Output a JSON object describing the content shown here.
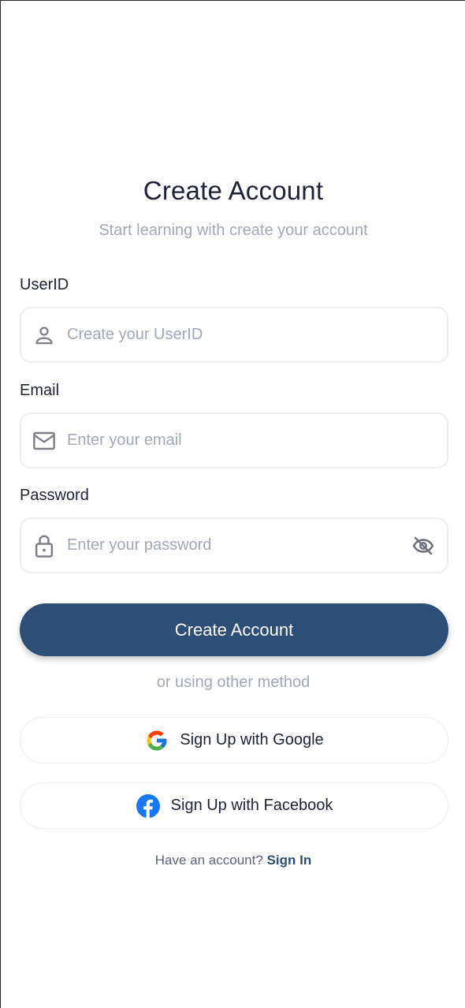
{
  "header": {
    "title": "Create Account",
    "subtitle": "Start learning with create your account"
  },
  "form": {
    "userid": {
      "label": "UserID",
      "placeholder": "Create your UserID",
      "value": "",
      "icon": "person-icon"
    },
    "email": {
      "label": "Email",
      "placeholder": "Enter your email",
      "value": "",
      "icon": "mail-icon"
    },
    "password": {
      "label": "Password",
      "placeholder": "Enter your password",
      "value": "",
      "icon": "lock-icon",
      "toggle_icon": "eye-off-icon"
    }
  },
  "actions": {
    "create_account_label": "Create Account",
    "divider_text": "or using other method",
    "google_label": "Sign Up with Google",
    "facebook_label": "Sign Up with Facebook"
  },
  "footer": {
    "prompt": "Have an account?",
    "link_label": "Sign In"
  },
  "colors": {
    "primary": "#2d4e76",
    "text_dark": "#1f2238",
    "text_muted": "#a3a8b8",
    "border": "#eeeff3",
    "facebook_blue": "#1877f2"
  }
}
